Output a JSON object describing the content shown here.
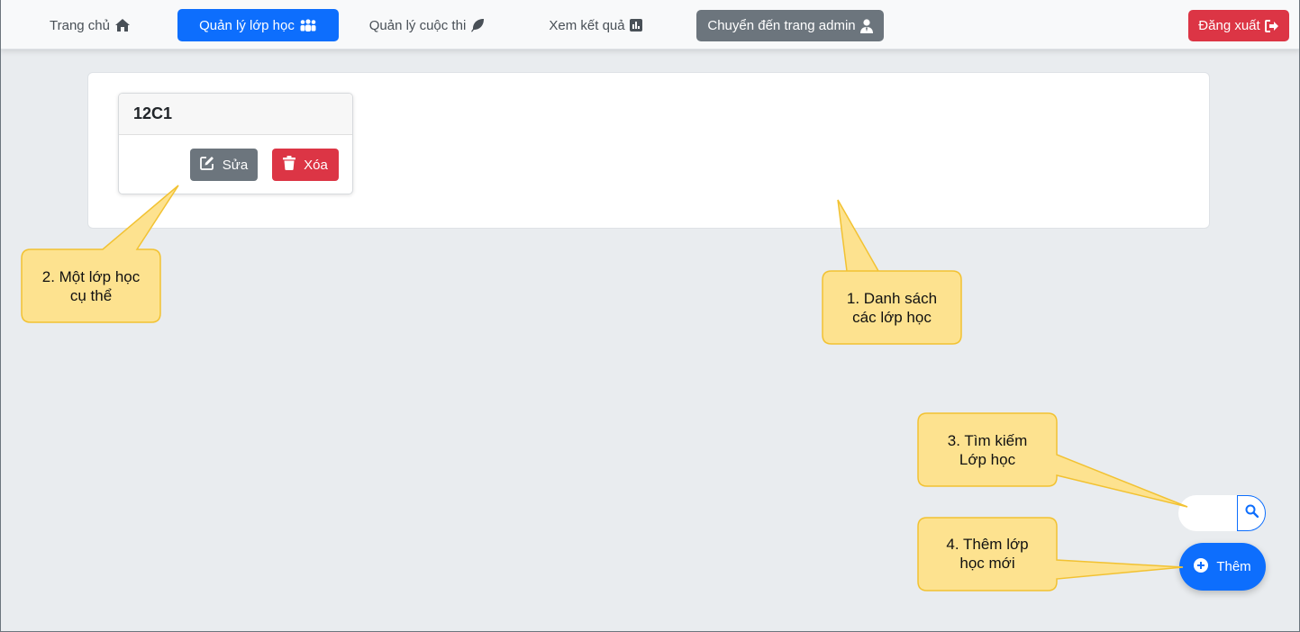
{
  "nav": {
    "home": "Trang chủ",
    "classes": "Quản lý lớp học",
    "contests": "Quản lý cuộc thi",
    "results": "Xem kết quả",
    "admin": "Chuyển đến trang admin",
    "logout": "Đăng xuất"
  },
  "class_list": {
    "items": [
      {
        "name": "12C1",
        "edit_label": "Sửa",
        "delete_label": "Xóa"
      }
    ]
  },
  "search": {
    "placeholder": "",
    "value": ""
  },
  "add_button": {
    "label": "Thêm"
  },
  "callouts": {
    "c1_line1": "1. Danh sách",
    "c1_line2": "các lớp học",
    "c2_line1": "2. Một lớp học",
    "c2_line2": "cụ thể",
    "c3_line1": "3. Tìm kiếm",
    "c3_line2": "Lớp học",
    "c4_line1": "4. Thêm lớp",
    "c4_line2": "học mới"
  },
  "colors": {
    "primary": "#0d6efd",
    "secondary": "#6c757d",
    "danger": "#dc3545",
    "callout_fill": "#fde28f",
    "callout_stroke": "#f2c232",
    "background": "#e9ecef"
  },
  "icons": {
    "home": "home-icon",
    "classes": "users-icon",
    "contests": "feather-icon",
    "results": "chart-icon",
    "admin": "user-tie-icon",
    "logout": "sign-out-icon",
    "edit": "edit-icon",
    "delete": "trash-icon",
    "search": "search-icon",
    "add": "plus-circle-icon"
  }
}
